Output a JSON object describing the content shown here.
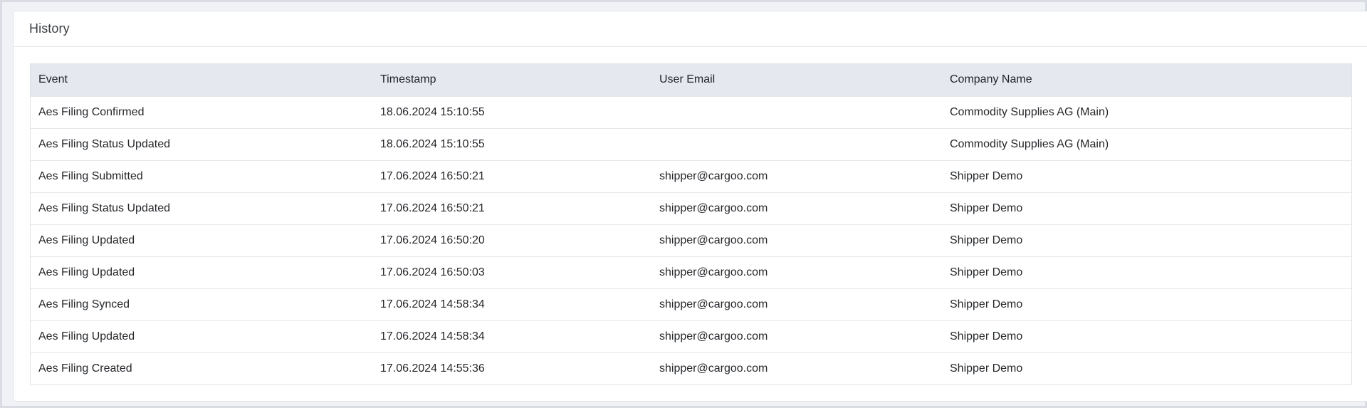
{
  "panel": {
    "title": "History"
  },
  "table": {
    "columns": [
      "Event",
      "Timestamp",
      "User Email",
      "Company Name"
    ],
    "rows": [
      {
        "event": "Aes Filing Confirmed",
        "timestamp": "18.06.2024 15:10:55",
        "email": "",
        "company": "Commodity Supplies AG (Main)"
      },
      {
        "event": "Aes Filing Status Updated",
        "timestamp": "18.06.2024 15:10:55",
        "email": "",
        "company": "Commodity Supplies AG (Main)"
      },
      {
        "event": "Aes Filing Submitted",
        "timestamp": "17.06.2024 16:50:21",
        "email": "shipper@cargoo.com",
        "company": "Shipper Demo"
      },
      {
        "event": "Aes Filing Status Updated",
        "timestamp": "17.06.2024 16:50:21",
        "email": "shipper@cargoo.com",
        "company": "Shipper Demo"
      },
      {
        "event": "Aes Filing Updated",
        "timestamp": "17.06.2024 16:50:20",
        "email": "shipper@cargoo.com",
        "company": "Shipper Demo"
      },
      {
        "event": "Aes Filing Updated",
        "timestamp": "17.06.2024 16:50:03",
        "email": "shipper@cargoo.com",
        "company": "Shipper Demo"
      },
      {
        "event": "Aes Filing Synced",
        "timestamp": "17.06.2024 14:58:34",
        "email": "shipper@cargoo.com",
        "company": "Shipper Demo"
      },
      {
        "event": "Aes Filing Updated",
        "timestamp": "17.06.2024 14:58:34",
        "email": "shipper@cargoo.com",
        "company": "Shipper Demo"
      },
      {
        "event": "Aes Filing Created",
        "timestamp": "17.06.2024 14:55:36",
        "email": "shipper@cargoo.com",
        "company": "Shipper Demo"
      }
    ]
  }
}
